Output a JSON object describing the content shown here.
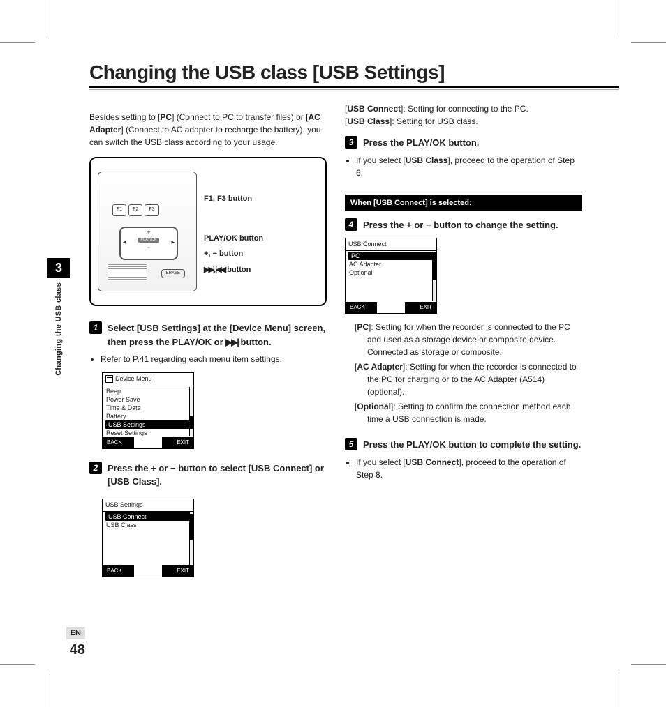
{
  "header": {
    "title": "Changing the USB class [USB Settings]"
  },
  "sidetab": {
    "chapter": "3",
    "vertical": "Changing the USB class",
    "lang": "EN",
    "page": "48"
  },
  "intro": {
    "p1a": "Besides setting to [",
    "p1b": "PC",
    "p1c": "] (Connect to PC to transfer files) or [",
    "p1d": "AC Adapter",
    "p1e": "] (Connect to AC adapter to recharge the battery), you can switch the USB class according to your usage."
  },
  "diagram": {
    "fkeys": [
      "F1",
      "F2",
      "F3"
    ],
    "play_label": "PLAY/OK",
    "erase": "ERASE",
    "labels": {
      "l1": "F1, F3 button",
      "l2": "PLAY/OK button",
      "l3": "+, − button",
      "l4a": "▶▶|, |◀◀",
      "l4b": " button"
    }
  },
  "step1": {
    "num": "1",
    "h_a": "Select [",
    "h_b": "USB Settings",
    "h_c": "] at the [",
    "h_d": "Device Menu",
    "h_e": "] screen, then press the ",
    "h_f": "PLAY/OK",
    "h_g": " or ",
    "h_h": "▶▶|",
    "h_i": " button.",
    "bullet": "Refer to P.41 regarding each menu item settings.",
    "lcd": {
      "title": "Device Menu",
      "items": [
        "Beep",
        "Power Save",
        "Time & Date",
        "Battery",
        "USB Settings",
        "Reset Settings"
      ],
      "selected": 4,
      "back": "BACK",
      "exit": "EXIT"
    }
  },
  "step2": {
    "num": "2",
    "h_a": "Press the ",
    "h_b": "+",
    "h_c": " or ",
    "h_d": "−",
    "h_e": " button to select [",
    "h_f": "USB Connect",
    "h_g": "] or [",
    "h_h": "USB Class",
    "h_i": "].",
    "lcd": {
      "title": "USB Settings",
      "items": [
        "USB Connect",
        "USB Class"
      ],
      "selected": 0,
      "back": "BACK",
      "exit": "EXIT"
    }
  },
  "col2_top": {
    "a": "[",
    "b": "USB Connect",
    "c": "]: Setting for connecting to the PC.",
    "d": "[",
    "e": "USB Class",
    "f": "]: Setting for USB class."
  },
  "step3": {
    "num": "3",
    "h_a": "Press the ",
    "h_b": "PLAY/OK",
    "h_c": " button.",
    "bul_a": "If you select [",
    "bul_b": "USB Class",
    "bul_c": "], proceed to the operation of Step 6."
  },
  "bar": "When [USB Connect] is selected:",
  "step4": {
    "num": "4",
    "h_a": "Press the ",
    "h_b": "+",
    "h_c": " or ",
    "h_d": "−",
    "h_e": " button to change the setting.",
    "lcd": {
      "title": "USB Connect",
      "items": [
        "PC",
        "AC Adapter",
        "Optional"
      ],
      "selected": 0,
      "back": "BACK",
      "exit": "EXIT"
    },
    "defs": {
      "d1a": "PC",
      "d1b": "]: Setting for when the recorder is connected to the PC and used as a storage device or composite device. Connected as storage or composite.",
      "d2a": "AC Adapter",
      "d2b": "]: Setting for when the recorder is connected to the PC for charging or to the AC Adapter (A514) (optional).",
      "d3a": "Optional",
      "d3b": "]: Setting to confirm the connection method each time a USB connection is made."
    }
  },
  "step5": {
    "num": "5",
    "h_a": "Press the ",
    "h_b": "PLAY/OK",
    "h_c": " button to complete the setting.",
    "bul_a": "If you select [",
    "bul_b": "USB Connect",
    "bul_c": "], proceed to the operation of Step 8."
  }
}
